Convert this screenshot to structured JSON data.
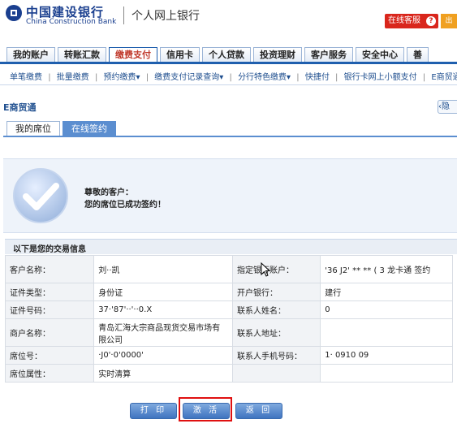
{
  "header": {
    "bank_name_cn": "中国建设银行",
    "bank_name_en": "China Construction Bank",
    "portal_title": "个人网上银行",
    "online_service": "在线客服",
    "exit_label": "出"
  },
  "main_tabs": [
    "我的账户",
    "转账汇款",
    "缴费支付",
    "信用卡",
    "个人贷款",
    "投资理财",
    "客户服务",
    "安全中心",
    "善"
  ],
  "sub_nav": [
    "单笔缴费",
    "|",
    "批量缴费",
    "|",
    "预约缴费▾",
    "|",
    "缴费支付记录查询▾",
    "|",
    "分行特色缴费▾",
    "|",
    "快捷付",
    "|",
    "银行卡网上小额支付",
    "|",
    "E商贸通"
  ],
  "section_title": "E商贸通",
  "hide_label": "隐",
  "sub_tabs": [
    "我的席位",
    "在线签约"
  ],
  "success": {
    "line1": "尊敬的客户：",
    "line2": "您的席位已成功签约！"
  },
  "info_title": "以下是您的交易信息",
  "info": {
    "customer_name_label": "客户名称：",
    "customer_name": "刘··凯",
    "account_label": "指定银行账户：",
    "account": "'36  J2'    ** **   ( 3 龙卡通  签约",
    "id_type_label": "证件类型：",
    "id_type": "身份证",
    "opening_bank_label": "开户银行：",
    "opening_bank": "建行",
    "id_number_label": "证件号码：",
    "id_number": "37·'87'··'··0.X",
    "contact_name_label": "联系人姓名：",
    "contact_name": "0",
    "merchant_label": "商户名称：",
    "merchant": "青岛汇海大宗商品现货交易市场有限公司",
    "contact_address_label": "联系人地址：",
    "contact_address": "",
    "seat_no_label": "席位号：",
    "seat_no": "·J0'·0'0000'",
    "contact_phone_label": "联系人手机号码：",
    "contact_phone": "1·  0910  09",
    "seat_attr_label": "席位属性：",
    "seat_attr": "实时清算"
  },
  "buttons": {
    "print": "打 印",
    "activate": "激 活",
    "back": "返 回"
  },
  "colors": {
    "brand_blue": "#1f5fae",
    "active_tab_red": "#c0392b",
    "service_red": "#d9261c",
    "highlight_red": "#e01010"
  }
}
